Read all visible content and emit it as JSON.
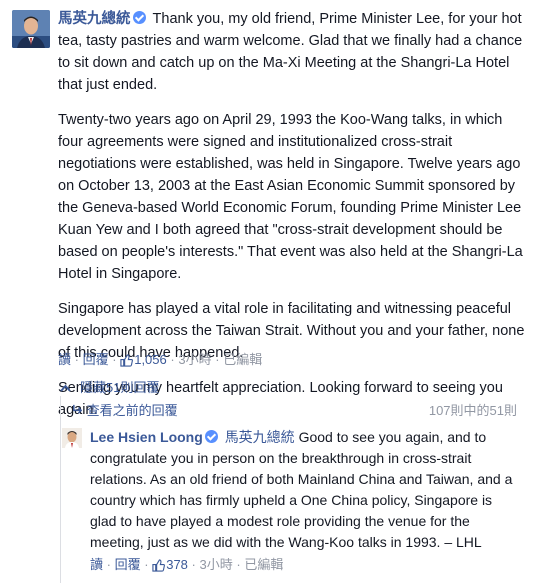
{
  "comment": {
    "author": "馬英九總統",
    "paragraphs": [
      "Thank you, my old friend, Prime Minister Lee, for your hot tea, tasty pastries and warm welcome. Glad that we finally had a chance to sit down and catch up on the Ma-Xi Meeting at the Shangri-La Hotel that just ended.",
      "Twenty-two years ago on April 29, 1993 the Koo-Wang talks, in which four agreements were signed and institutionalized cross-strait negotiations were established, was held in Singapore. Twelve years ago on October 13, 2003 at the East Asian Economic Summit sponsored by the Geneva-based World Economic Forum, founding Prime Minister Lee Kuan Yew and I both agreed that \"cross-strait development should be based on people's interests.\" That event was also held at the Shangri-La Hotel in Singapore.",
      "Singapore has played a vital role in facilitating and witnessing peaceful development across the Taiwan Strait. Without you and your father, none of this could have happened.",
      "Sending you my heartfelt appreciation. Looking forward to seeing you again."
    ],
    "actions": {
      "read": "讀",
      "reply": "回覆",
      "likes": "1,056",
      "time": "3小時",
      "edited": "已編輯"
    }
  },
  "thread": {
    "hidden_replies": "隱藏51則回覆",
    "view_previous": "查看之前的回覆",
    "count": "107則中的51則"
  },
  "reply": {
    "author": "Lee Hsien Loong",
    "tag": "馬英九總統",
    "text": "Good to see you again, and to congratulate you in person on the breakthrough in cross-strait relations. As an old friend of both Mainland China and Taiwan, and a country which has firmly upheld a One China policy, Singapore is glad to have played a modest role providing the venue for the meeting, just as we did with the Wang-Koo talks in 1993. – LHL",
    "actions": {
      "read": "讀",
      "reply": "回覆",
      "likes": "378",
      "time": "3小時",
      "edited": "已編輯"
    }
  },
  "colors": {
    "link": "#3b5998",
    "meta": "#9197a3",
    "verified": "#5890ff"
  }
}
